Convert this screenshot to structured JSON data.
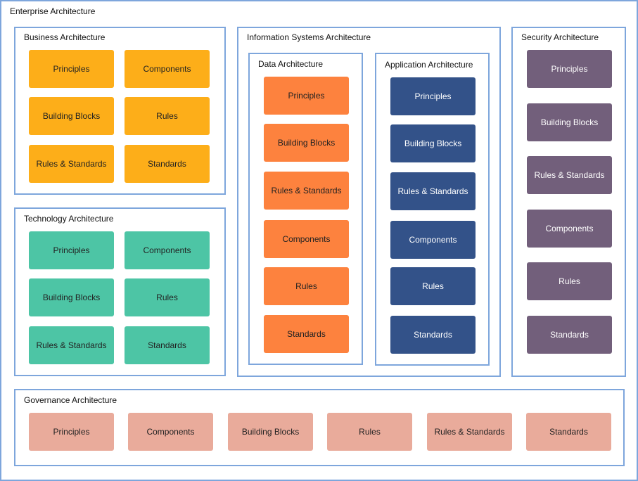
{
  "enterprise": {
    "title": "Enterprise Architecture"
  },
  "business": {
    "title": "Business Architecture",
    "color": "#fdae19",
    "items": [
      "Principles",
      "Components",
      "Building Blocks",
      "Rules",
      "Rules & Standards",
      "Standards"
    ]
  },
  "technology": {
    "title": "Technology Architecture",
    "color": "#4dc5a5",
    "items": [
      "Principles",
      "Components",
      "Building Blocks",
      "Rules",
      "Rules & Standards",
      "Standards"
    ]
  },
  "information_systems": {
    "title": "Information Systems Architecture",
    "data": {
      "title": "Data Architecture",
      "color": "#fd823e",
      "items": [
        "Principles",
        "Building Blocks",
        "Rules & Standards",
        "Components",
        "Rules",
        "Standards"
      ]
    },
    "application": {
      "title": "Application Architecture",
      "color": "#335289",
      "items": [
        "Principles",
        "Building Blocks",
        "Rules & Standards",
        "Components",
        "Rules",
        "Standards"
      ]
    }
  },
  "security": {
    "title": "Security Architecture",
    "color": "#725f7b",
    "items": [
      "Principles",
      "Building Blocks",
      "Rules & Standards",
      "Components",
      "Rules",
      "Standards"
    ]
  },
  "governance": {
    "title": "Governance Architecture",
    "color": "#e9ab9b",
    "items": [
      "Principles",
      "Components",
      "Building Blocks",
      "Rules",
      "Rules & Standards",
      "Standards"
    ]
  },
  "frame_color": "#7ea6dc"
}
